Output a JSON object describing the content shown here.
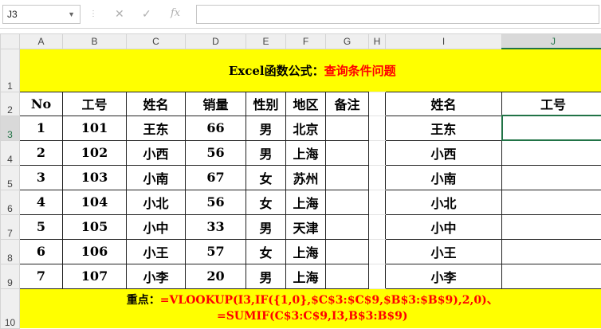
{
  "formula_bar": {
    "name_box": "J3",
    "formula": "",
    "icons": [
      "cancel-icon",
      "enter-icon",
      "function-icon"
    ]
  },
  "columns": [
    "A",
    "B",
    "C",
    "D",
    "E",
    "F",
    "G",
    "H",
    "I",
    "J"
  ],
  "selected_column": "J",
  "rows": [
    "1",
    "2",
    "3",
    "4",
    "5",
    "6",
    "7",
    "8",
    "9",
    "10"
  ],
  "selected_row": "3",
  "title": {
    "part1": "Excel函数公式：",
    "part2": "查询条件问题"
  },
  "headers": {
    "no": "No",
    "id": "工号",
    "name": "姓名",
    "sales": "销量",
    "gender": "性别",
    "region": "地区",
    "remark": "备注",
    "lookup_name": "姓名",
    "lookup_id": "工号"
  },
  "records": [
    {
      "no": "1",
      "id": "101",
      "name": "王东",
      "sales": "66",
      "gender": "男",
      "region": "北京",
      "remark": ""
    },
    {
      "no": "2",
      "id": "102",
      "name": "小西",
      "sales": "56",
      "gender": "男",
      "region": "上海",
      "remark": ""
    },
    {
      "no": "3",
      "id": "103",
      "name": "小南",
      "sales": "67",
      "gender": "女",
      "region": "苏州",
      "remark": ""
    },
    {
      "no": "4",
      "id": "104",
      "name": "小北",
      "sales": "56",
      "gender": "女",
      "region": "上海",
      "remark": ""
    },
    {
      "no": "5",
      "id": "105",
      "name": "小中",
      "sales": "33",
      "gender": "男",
      "region": "天津",
      "remark": ""
    },
    {
      "no": "6",
      "id": "106",
      "name": "小王",
      "sales": "57",
      "gender": "女",
      "region": "上海",
      "remark": ""
    },
    {
      "no": "7",
      "id": "107",
      "name": "小李",
      "sales": "20",
      "gender": "男",
      "region": "上海",
      "remark": ""
    }
  ],
  "lookup": [
    {
      "name": "王东",
      "id": ""
    },
    {
      "name": "小西",
      "id": ""
    },
    {
      "name": "小南",
      "id": ""
    },
    {
      "name": "小北",
      "id": ""
    },
    {
      "name": "小中",
      "id": ""
    },
    {
      "name": "小王",
      "id": ""
    },
    {
      "name": "小李",
      "id": ""
    }
  ],
  "note": {
    "label": "重点：",
    "line1": "=VLOOKUP(I3,IF({1,0},$C$3:$C$9,$B$3:$B$9),2,0)、",
    "line2": "=SUMIF(C$3:C$9,I3,B$3:B$9)"
  },
  "colors": {
    "highlight": "#ffff00",
    "accent": "#217346",
    "emphasis": "#ff0000"
  }
}
